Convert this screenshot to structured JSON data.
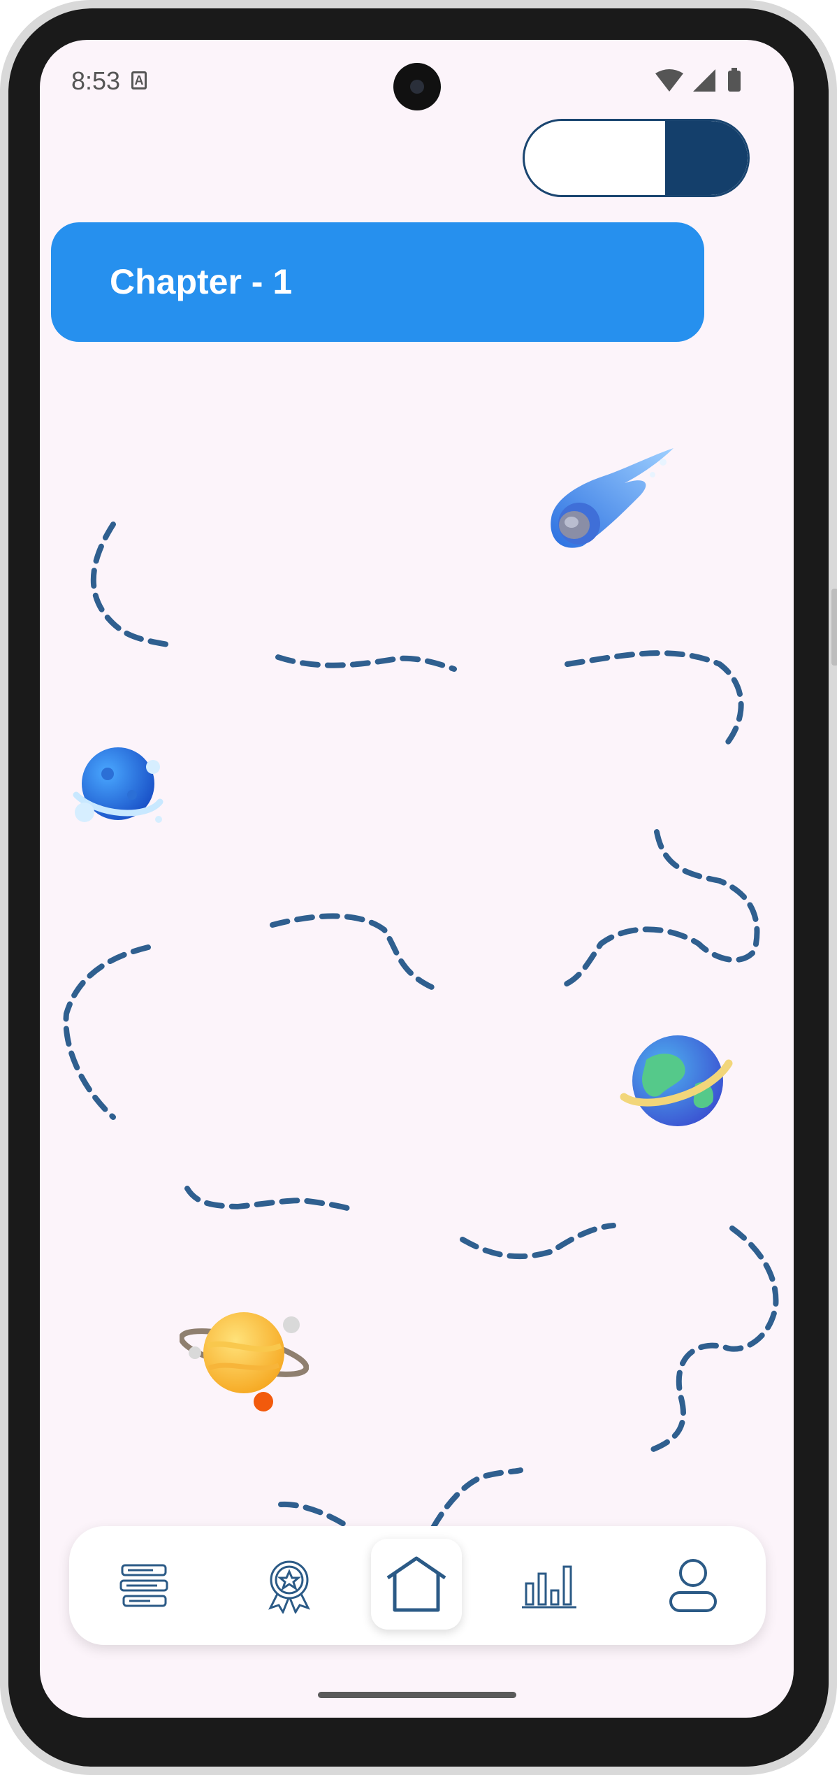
{
  "status_bar": {
    "time": "8:53",
    "notification_icon": "a-icon",
    "icons": [
      "wifi-icon",
      "signal-icon",
      "battery-icon"
    ]
  },
  "toggle": {
    "state": "on"
  },
  "chapter": {
    "title": "Chapter - 1"
  },
  "map": {
    "planets": [
      "comet-icon",
      "blue-planet-icon",
      "earth-planet-icon",
      "saturn-planet-icon"
    ]
  },
  "bottom_nav": {
    "items": [
      {
        "name": "library-icon",
        "active": false
      },
      {
        "name": "award-icon",
        "active": false
      },
      {
        "name": "home-icon",
        "active": true
      },
      {
        "name": "stats-icon",
        "active": false
      },
      {
        "name": "profile-icon",
        "active": false
      }
    ]
  },
  "colors": {
    "background": "#fcf4fa",
    "banner": "#2690ee",
    "primary_dark": "#143f6b",
    "path": "#2f5f8f"
  }
}
